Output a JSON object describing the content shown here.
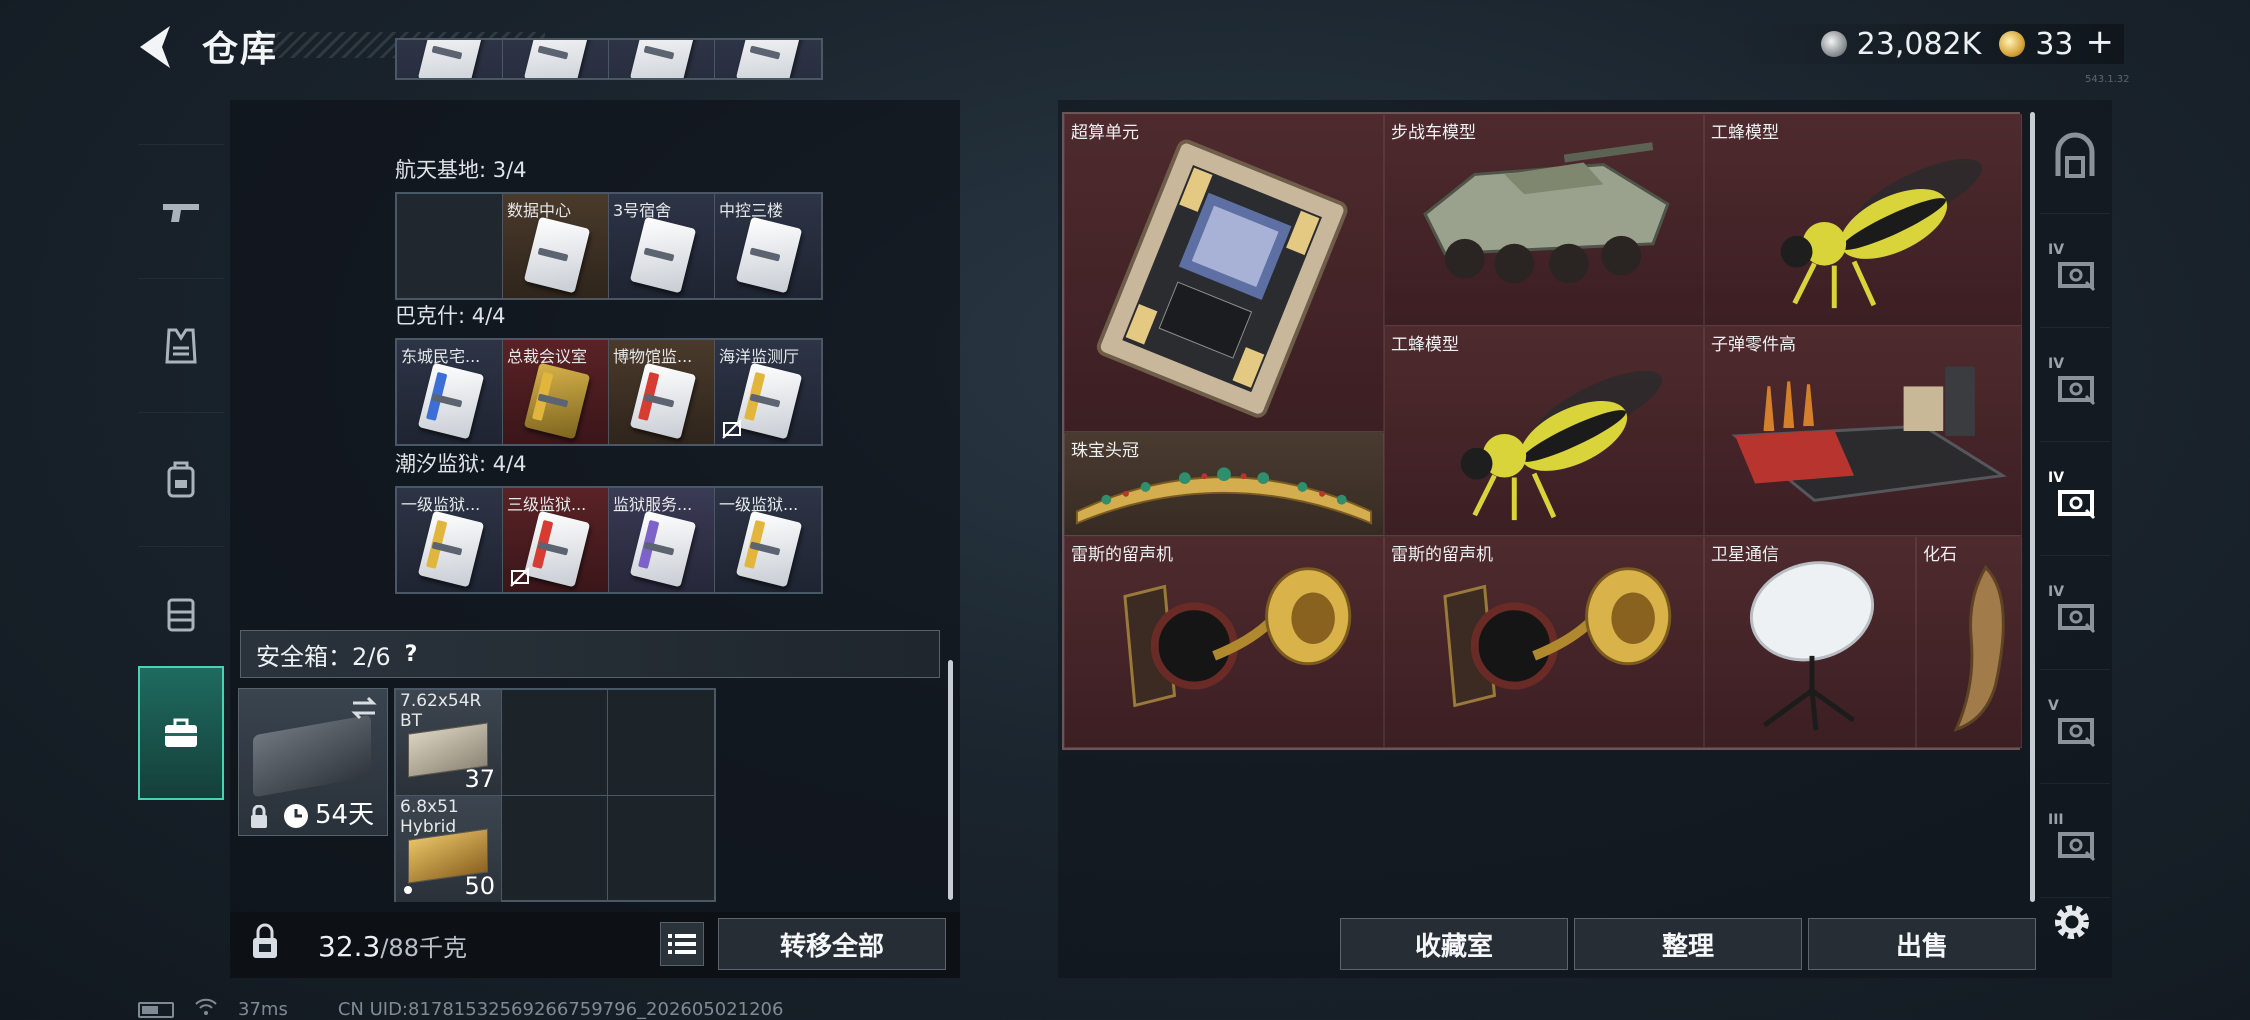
{
  "header": {
    "title": "仓库",
    "silver_amount": "23,082K",
    "gold_amount": "33",
    "plus_label": "+",
    "version": "543.1.32"
  },
  "category_tabs": [
    {
      "icon": "gun-icon"
    },
    {
      "icon": "armor-vest-icon"
    },
    {
      "icon": "backpack-icon"
    },
    {
      "icon": "chest-rig-icon"
    },
    {
      "icon": "safebox-icon",
      "active": true
    }
  ],
  "keycard_sections": [
    {
      "label": "航天基地: 3/4",
      "slots": [
        {
          "name": "",
          "empty": true
        },
        {
          "name": "数据中心",
          "bg": "brown",
          "stripe": ""
        },
        {
          "name": "3号宿舍",
          "bg": "navy",
          "stripe": ""
        },
        {
          "name": "中控三楼",
          "bg": "navy",
          "stripe": ""
        }
      ]
    },
    {
      "label": "巴克什: 4/4",
      "slots": [
        {
          "name": "东城民宅...",
          "bg": "navy",
          "stripe": "blue"
        },
        {
          "name": "总裁会议室",
          "bg": "red",
          "stripe": "gold",
          "yellow": true
        },
        {
          "name": "博物馆监...",
          "bg": "brown",
          "stripe": "red"
        },
        {
          "name": "海洋监测厅",
          "bg": "navy",
          "stripe": "gold",
          "no_trade": true
        }
      ]
    },
    {
      "label": "潮汐监狱: 4/4",
      "slots": [
        {
          "name": "一级监狱...",
          "bg": "navy",
          "stripe": "gold"
        },
        {
          "name": "三级监狱...",
          "bg": "red",
          "stripe": "red",
          "no_trade": true
        },
        {
          "name": "监狱服务...",
          "bg": "purple",
          "stripe": "purple"
        },
        {
          "name": "一级监狱...",
          "bg": "navy",
          "stripe": "gold"
        }
      ]
    }
  ],
  "safebox": {
    "label": "安全箱：2/6",
    "help": "?",
    "days_left": "54天",
    "ammo": [
      {
        "name_line1": "7.62x54R",
        "name_line2": "BT",
        "count": "37"
      },
      {
        "name_line1": "6.8x51",
        "name_line2": "Hybrid",
        "count": "50"
      }
    ]
  },
  "capacity": {
    "current": "32.3",
    "max_unit": "/88千克"
  },
  "buttons": {
    "transfer_all": "转移全部",
    "collection_room": "收藏室",
    "organize": "整理",
    "sell": "出售"
  },
  "status_bar": {
    "ping": "37ms",
    "uid": "CN UID:8178153256926675979​6_202605021206"
  },
  "collection": [
    {
      "name": "超算单元",
      "art": "supercomputer-unit"
    },
    {
      "name": "步战车模型",
      "art": "ifv-model"
    },
    {
      "name": "工蜂模型",
      "art": "worker-bee-model"
    },
    {
      "name": "工蜂模型",
      "art": "worker-bee-model"
    },
    {
      "name": "子弹零件高",
      "art": "bullet-parts"
    },
    {
      "name": "珠宝头冠",
      "art": "jewel-crown"
    },
    {
      "name": "雷斯的留声机",
      "art": "gramophone"
    },
    {
      "name": "雷斯的留声机",
      "art": "gramophone"
    },
    {
      "name": "卫星通信",
      "art": "satellite-dish"
    },
    {
      "name": "化石",
      "art": "fossil-claw"
    }
  ],
  "side_tabs": [
    {
      "icon": "vault-door-icon",
      "roman": ""
    },
    {
      "icon": "tier-iv-plus-icon",
      "roman": "IV"
    },
    {
      "icon": "tier-iv-folder-icon",
      "roman": "IV"
    },
    {
      "icon": "tier-iv-collection-icon",
      "roman": "IV",
      "active": true
    },
    {
      "icon": "tier-iv-collection-alt-icon",
      "roman": "IV"
    },
    {
      "icon": "tier-v-collection-icon",
      "roman": "V"
    },
    {
      "icon": "tier-iii-collection-icon",
      "roman": "III"
    }
  ]
}
